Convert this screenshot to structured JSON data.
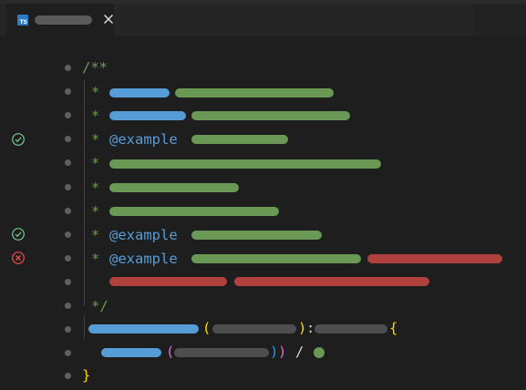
{
  "tab": {
    "icon_label": "TS"
  },
  "code": {
    "doc_open": "/**",
    "star": "*",
    "doc_close": "*/",
    "example_tag": "@example",
    "paren_open": "(",
    "paren_close": ")",
    "colon": ":",
    "brace_open": "{",
    "brace_close": "}",
    "inner_paren_open": "(",
    "inner_paren_close_1": ")",
    "inner_paren_close_2": ")",
    "slash": "/"
  },
  "tests": {
    "line_153": "passed",
    "line_257": "passed",
    "line_283": "failed"
  },
  "colors": {
    "comment": "#6a9955",
    "tag": "#569cd6",
    "error": "#b0413e",
    "pass_icon": "#73c991",
    "fail_icon": "#f14c4c"
  }
}
